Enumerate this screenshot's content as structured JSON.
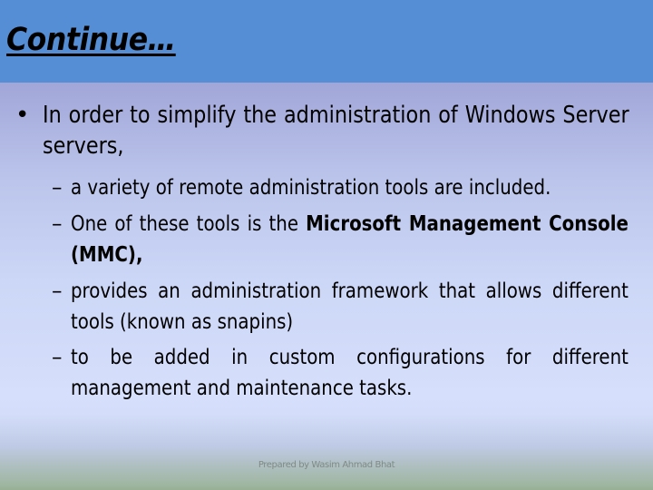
{
  "slide": {
    "title": "Continue…",
    "colors": {
      "title_bar": "#558ed5",
      "text": "#000000",
      "footer_text": "#7f8a86"
    },
    "bullets": [
      {
        "marker": "•",
        "text": "In order to simplify the administration of Windows Server servers,",
        "sub_items": [
          {
            "marker": "–",
            "text": "a variety of remote administration tools are included."
          },
          {
            "marker": "–",
            "pre": "One of these tools is the ",
            "bold": "Microsoft Management Console (MMC),",
            "post": ""
          },
          {
            "marker": "–",
            "text": "provides an administration framework that allows different tools (known as snapins)"
          },
          {
            "marker": "–",
            "text": "to be added in custom configurations for different management and maintenance tasks."
          }
        ]
      }
    ],
    "footer": "Prepared by Wasim Ahmad Bhat"
  }
}
